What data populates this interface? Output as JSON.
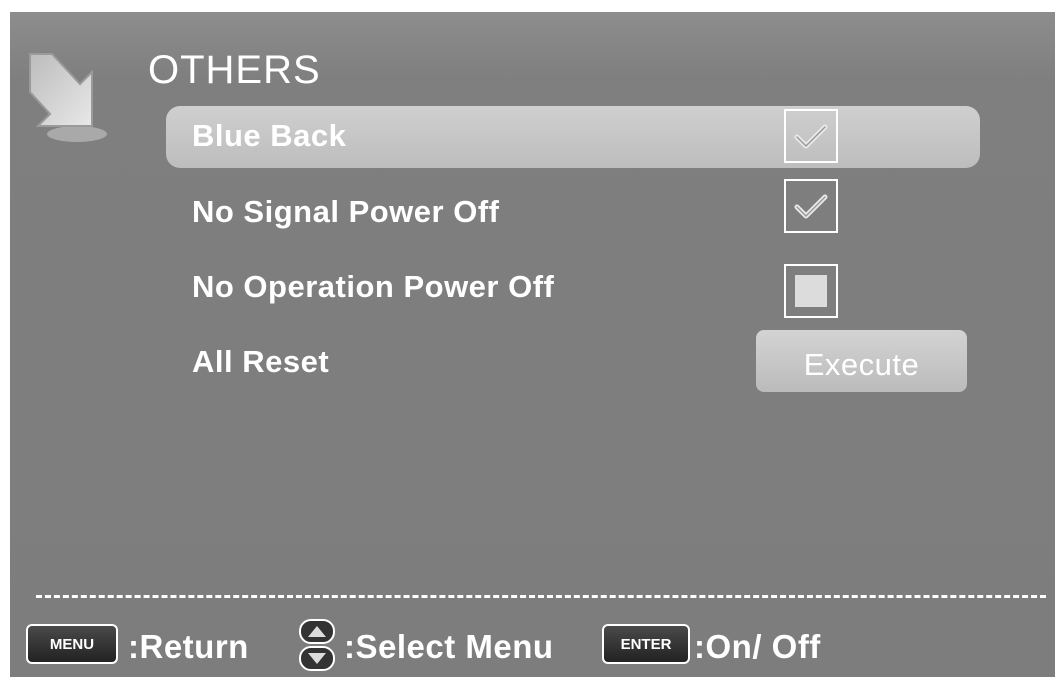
{
  "menu": {
    "title": "OTHERS",
    "items": [
      {
        "label": "Blue Back",
        "control": "checkbox",
        "checked": true,
        "selected": true
      },
      {
        "label": "No Signal Power Off",
        "control": "checkbox",
        "checked": true,
        "selected": false
      },
      {
        "label": "No Operation Power Off",
        "control": "checkbox",
        "checked": false,
        "selected": false
      },
      {
        "label": "All Reset",
        "control": "button",
        "button_label": "Execute",
        "selected": false
      }
    ]
  },
  "footer": {
    "menu_key": "MENU",
    "menu_action": ":Return",
    "select_icon": "up-down-arrows-icon",
    "select_action": ":Select Menu",
    "enter_key": "ENTER",
    "enter_action": ":On/ Off"
  },
  "icons": {
    "corner": "arrow-down-right-icon",
    "check": "checkmark-icon"
  },
  "colors": {
    "background": "#7f7f7f",
    "highlight": "#c4c4c4",
    "text": "#ffffff"
  }
}
